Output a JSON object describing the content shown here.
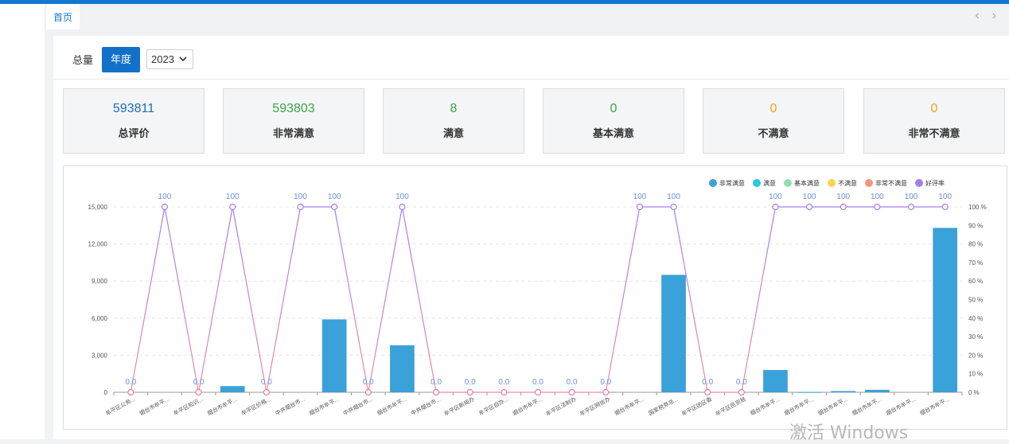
{
  "tabs": {
    "home": "首页",
    "nav_prev": "‹",
    "nav_next": "›"
  },
  "filter": {
    "total_label": "总量",
    "year_label": "年度",
    "year_value": "2023",
    "chevron": "chevron-down-icon"
  },
  "stats": [
    {
      "value": "593811",
      "label": "总评价",
      "color": "#1a6fb8"
    },
    {
      "value": "593803",
      "label": "非常满意",
      "color": "#3aa548"
    },
    {
      "value": "8",
      "label": "满意",
      "color": "#3aa548"
    },
    {
      "value": "0",
      "label": "基本满意",
      "color": "#3aa548"
    },
    {
      "value": "0",
      "label": "不满意",
      "color": "#f2a51e"
    },
    {
      "value": "0",
      "label": "非常不满意",
      "color": "#f2a51e"
    }
  ],
  "chart_data": {
    "type": "bar",
    "categories": [
      "牟平区公务...",
      "烟台市牟平...",
      "牟平区知识...",
      "烟台市牟平...",
      "牟平区价格...",
      "中共烟台市...",
      "烟台市牟平...",
      "中共烟台市...",
      "烟台市牟平...",
      "中共烟台市...",
      "牟平区新闻办",
      "牟平区自办...",
      "烟台市牟平...",
      "牟平区法制办",
      "牟平区网信办",
      "烟台市牟平...",
      "国家税务总...",
      "牟平区团区委",
      "牟平区民宗局",
      "烟台市牟平...",
      "烟台市牟平...",
      "烟台市牟平...",
      "烟台市牟平...",
      "烟台市牟平...",
      "烟台市牟平..."
    ],
    "series": [
      {
        "name": "非常满意",
        "type": "bar",
        "color": "#3ba1d9",
        "values": [
          0,
          0,
          0,
          500,
          0,
          0,
          5900,
          0,
          3800,
          0,
          0,
          0,
          0,
          0,
          0,
          0,
          9500,
          0,
          0,
          1800,
          20,
          100,
          200,
          0,
          13300
        ]
      },
      {
        "name": "满意",
        "type": "bar",
        "color": "#29c6e0",
        "values": []
      },
      {
        "name": "基本满意",
        "type": "bar",
        "color": "#91dfb5",
        "values": []
      },
      {
        "name": "不满意",
        "type": "bar",
        "color": "#fbd54b",
        "values": []
      },
      {
        "name": "非常不满意",
        "type": "bar",
        "color": "#f5967a",
        "values": []
      },
      {
        "name": "好评率",
        "type": "line",
        "color": "#a77ef0",
        "axis": "right",
        "values": [
          0,
          100,
          0,
          100,
          0,
          100,
          100,
          0,
          100,
          0,
          0,
          0,
          0,
          0,
          0,
          100,
          100,
          0,
          0,
          100,
          100,
          100,
          100,
          100,
          100
        ]
      }
    ],
    "point_labels": [
      "0.0",
      "100",
      "0.0",
      "100",
      "0.0",
      "100",
      "100",
      "0.0",
      "100",
      "0.0",
      "0.0",
      "0.0",
      "0.0",
      "0.0",
      "0.0",
      "100",
      "100",
      "0.0",
      "0.0",
      "100",
      "100",
      "100",
      "100",
      "100",
      "100"
    ],
    "y_left": {
      "min": 0,
      "max": 15000,
      "ticks": [
        "0",
        "3,000",
        "6,000",
        "9,000",
        "12,000",
        "15,000"
      ]
    },
    "y_right": {
      "min": 0,
      "max": 100,
      "ticks": [
        "0 %",
        "10 %",
        "20 %",
        "30 %",
        "40 %",
        "50 %",
        "60 %",
        "70 %",
        "80 %",
        "90 %",
        "100 %"
      ]
    },
    "grid": true,
    "legend_position": "top-right"
  },
  "watermark": "激活 Windows"
}
